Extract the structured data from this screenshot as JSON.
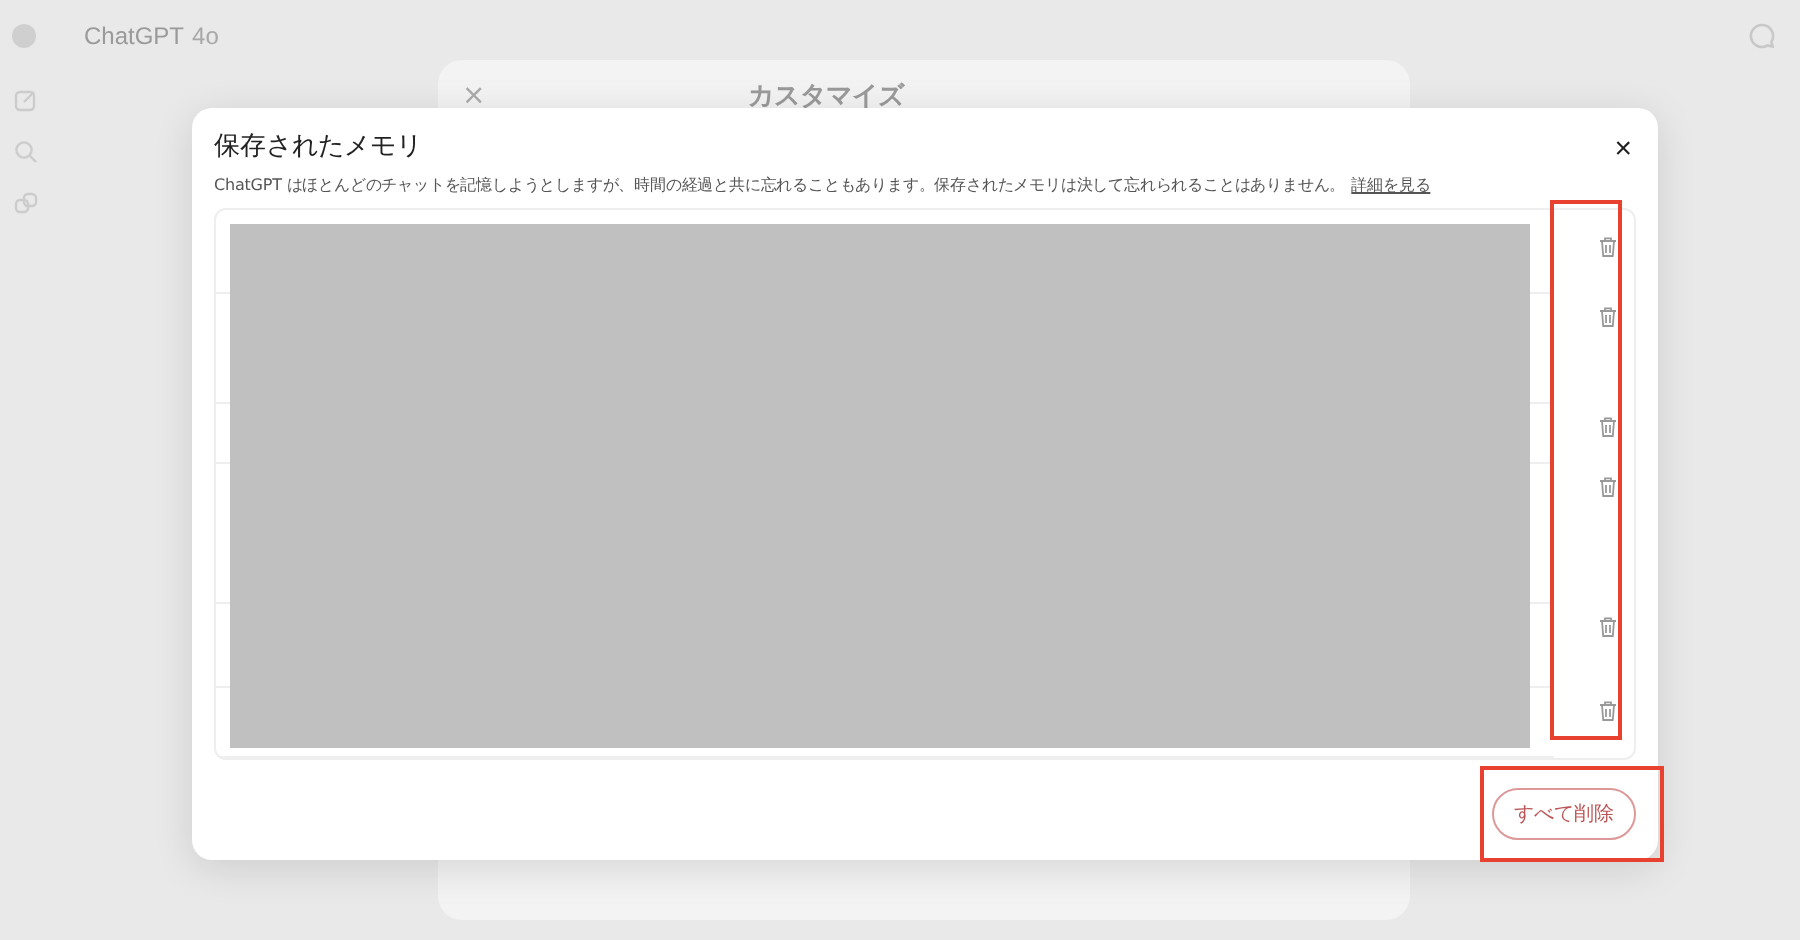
{
  "app": {
    "title": "ChatGPT",
    "model": "4o"
  },
  "background_dialog": {
    "title": "カスタマイズ",
    "close": "×"
  },
  "dialog": {
    "title": "保存されたメモリ",
    "description": "ChatGPT はほとんどのチャットを記憶しようとしますが、時間の経過と共に忘れることもあります。保存されたメモリは決して忘れられることはありません。",
    "link": "詳細を見る",
    "close": "×",
    "memories": [
      {
        "kind": "memory"
      },
      {
        "kind": "memory"
      },
      {
        "kind": "memory"
      },
      {
        "kind": "memory"
      },
      {
        "kind": "memory"
      },
      {
        "kind": "memory"
      }
    ],
    "delete_all": "すべて削除"
  }
}
